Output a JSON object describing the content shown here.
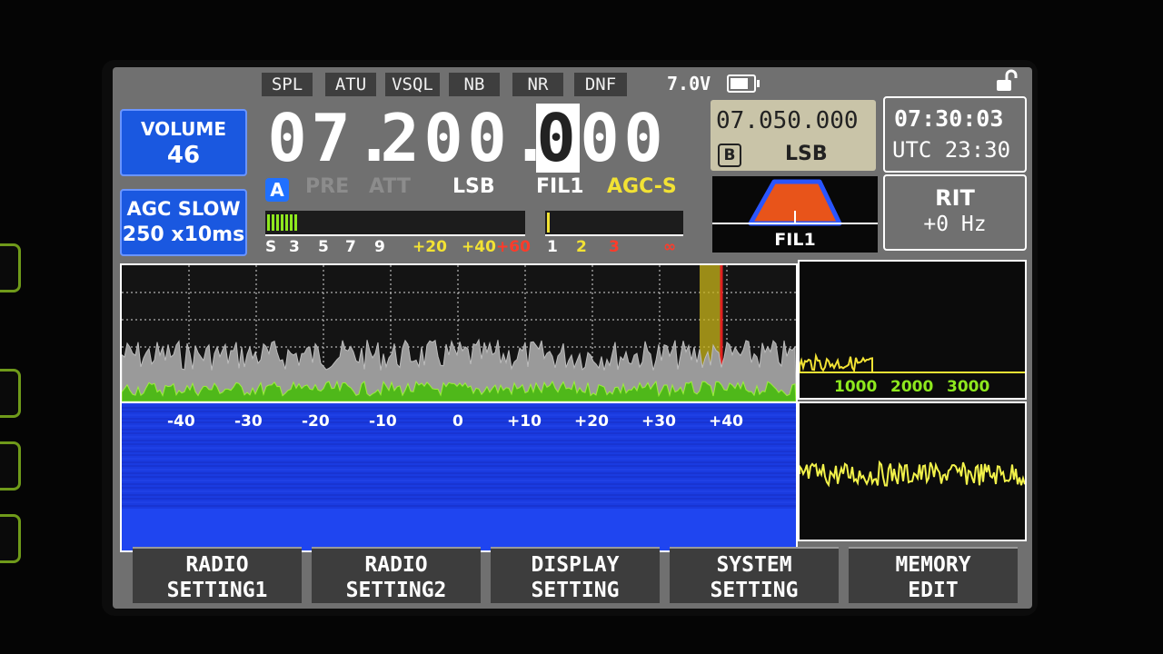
{
  "top_tags": [
    {
      "label": "SPL"
    },
    {
      "label": "ATU"
    },
    {
      "label": "VSQL"
    },
    {
      "label": "NB"
    },
    {
      "label": "NR"
    },
    {
      "label": "DNF"
    }
  ],
  "battery": {
    "voltage": "7.0V",
    "level": 0.8
  },
  "volume": {
    "label": "VOLUME",
    "value": "46"
  },
  "agc_box": {
    "label": "AGC SLOW",
    "value": "250 x10ms"
  },
  "vfo_a": {
    "frequency_digits": [
      "0",
      "7",
      ".",
      "2",
      "0",
      "0",
      ".",
      "0",
      "0",
      "0"
    ],
    "cursor_index": 7,
    "vfo_label": "A",
    "pre": "PRE",
    "att": "ATT",
    "mode": "LSB",
    "filter": "FIL1",
    "agc": "AGC-S"
  },
  "s_meter": {
    "scale": [
      "S",
      "3",
      "5",
      "7",
      "9",
      "+20",
      "+40",
      "+60"
    ],
    "level": 0.12
  },
  "swr_meter": {
    "scale": [
      "1",
      "2",
      "3",
      "∞"
    ],
    "level": 0.02
  },
  "vfo_b": {
    "frequency": "07.050.000",
    "label": "B",
    "mode": "LSB"
  },
  "clock": {
    "local": "07:30:03",
    "utc": "UTC 23:30"
  },
  "rit": {
    "label": "RIT",
    "value": "+0 Hz"
  },
  "filter_display": {
    "label": "FIL1"
  },
  "spectrum": {
    "offsets": [
      "-40",
      "-30",
      "-20",
      "-10",
      "0",
      "+10",
      "+20",
      "+30",
      "+40"
    ]
  },
  "audio_spectrum": {
    "ticks": [
      "1000",
      "2000",
      "3000"
    ]
  },
  "menu": [
    {
      "line1": "RADIO",
      "line2": "SETTING1"
    },
    {
      "line1": "RADIO",
      "line2": "SETTING2"
    },
    {
      "line1": "DISPLAY",
      "line2": "SETTING"
    },
    {
      "line1": "SYSTEM",
      "line2": "SETTING"
    },
    {
      "line1": "MEMORY",
      "line2": "EDIT"
    }
  ],
  "colors": {
    "accent_blue": "#1a58e0",
    "agc_yellow": "#f2e234",
    "meter_green": "#8ee81e",
    "waterfall_blue": "#1a3be0",
    "filter_orange": "#e8541a"
  }
}
